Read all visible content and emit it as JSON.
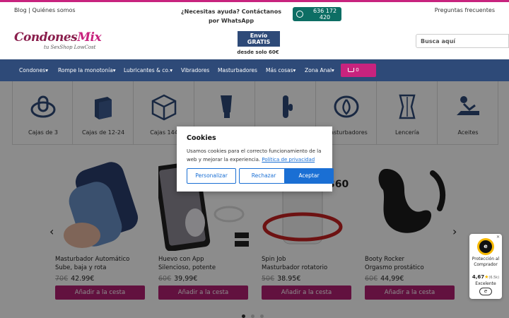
{
  "topbar": {
    "left_links": "Blog | Quiénes somos",
    "help_text": "¿Necesitas ayuda? Contáctanos por WhatsApp",
    "whatsapp_number": "636 172 420",
    "faq_link": "Preguntas frecuentes"
  },
  "header": {
    "logo_main": "Condones",
    "logo_accent": "Mix",
    "logo_tagline": "tu SexShop LowCost",
    "shipping_badge": "Envío GRATIS",
    "shipping_sub": "desde solo 60€",
    "search_placeholder": "Busca aquí"
  },
  "nav": {
    "items": [
      "Condones",
      "Rompe la monotonía",
      "Lubricantes & co.",
      "Vibradores",
      "Masturbadores",
      "Más cosas",
      "Zona Anal"
    ],
    "cart_count": "0"
  },
  "categories": [
    {
      "label": "Cajas de 3",
      "icon": "condom-icon"
    },
    {
      "label": "Cajas de 12-24",
      "icon": "box-icon"
    },
    {
      "label": "Cajas 144",
      "icon": "package-icon"
    },
    {
      "label": "",
      "icon": "lube-tube-icon"
    },
    {
      "label": "",
      "icon": "vibrator-icon"
    },
    {
      "label": "Masturbadores",
      "icon": "masturbator-icon"
    },
    {
      "label": "Lencería",
      "icon": "corset-icon"
    },
    {
      "label": "Aceites",
      "icon": "massage-icon"
    }
  ],
  "products": [
    {
      "name": "Masturbador Automático",
      "desc": "Sube, baja y rota",
      "old_price": "70€",
      "price": "42.99€",
      "button": "Añadir a la cesta",
      "img": "masturbator-image"
    },
    {
      "name": "Huevo con App",
      "desc": "Silencioso, potente",
      "old_price": "60€",
      "price": "39,99€",
      "button": "Añadir a la cesta",
      "img": "egg-app-image"
    },
    {
      "name": "Spin Job",
      "desc": "Masturbador rotatorio",
      "old_price": "50€",
      "price": "38.95€",
      "button": "Añadir a la cesta",
      "img": "spin-job-image"
    },
    {
      "name": "Booty Rocker",
      "desc": "Orgasmo prostático",
      "old_price": "60€",
      "price": "44,99€",
      "button": "Añadir a la cesta",
      "img": "prostate-image"
    }
  ],
  "carousel": {
    "prev": "‹",
    "next": "›",
    "dots": 3,
    "active_dot": 1
  },
  "cookie_modal": {
    "title": "Cookies",
    "text": "Usamos cookies para el correcto funcionamiento de la web y mejorar la experiencia.",
    "policy_link": "Política de privacidad",
    "btn_customize": "Personalizar",
    "btn_reject": "Rechazar",
    "btn_accept": "Aceptar"
  },
  "trust_badge": {
    "seal": "e",
    "label": "Protección al Comprador",
    "rating": "4,67",
    "reviews": "(6.5k)",
    "verdict": "Excelente",
    "close": "✕"
  },
  "colors": {
    "brand_pink": "#c8237e",
    "nav_blue": "#2e4a78",
    "button_pink": "#b21f73",
    "whatsapp_green": "#0d6e64",
    "accept_blue": "#1a6fd4"
  }
}
